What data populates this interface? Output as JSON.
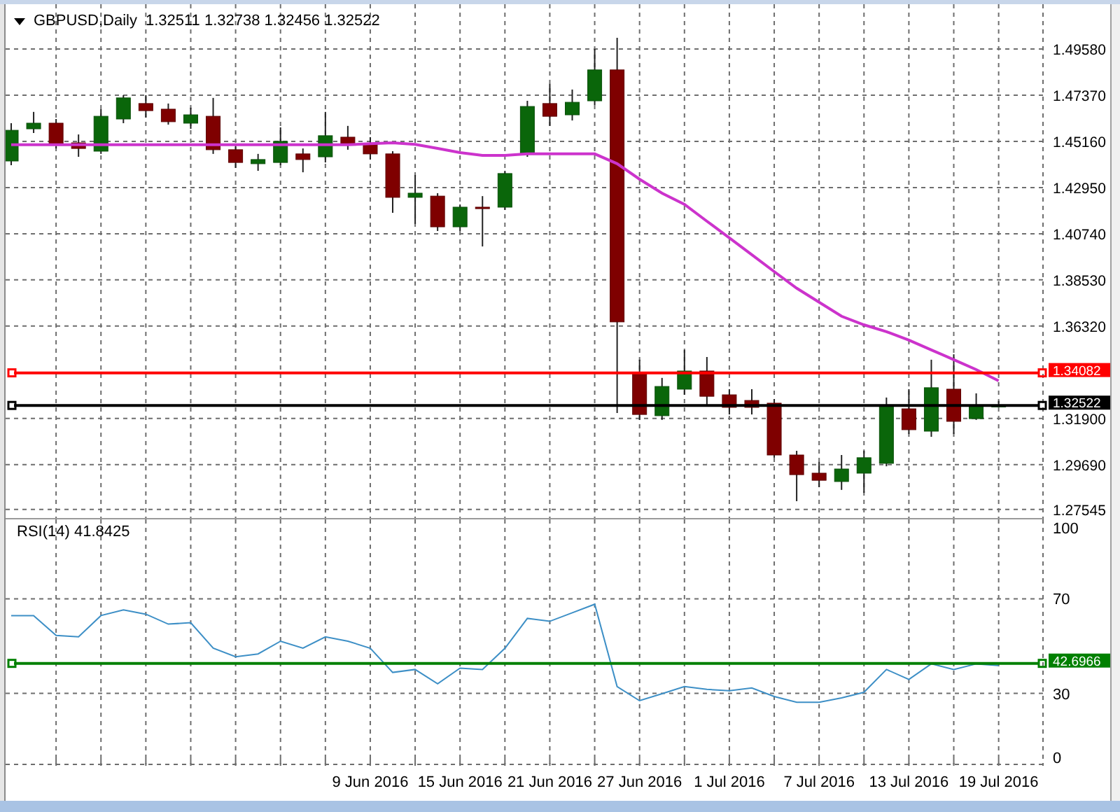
{
  "price_panel": {
    "symbol": "GBPUSD,Daily",
    "ohlc_text": "1.32511 1.32738 1.32456 1.32522",
    "chart_data": {
      "type": "candlestick",
      "grid": true,
      "ylim": [
        1.27068,
        1.51724
      ],
      "categories": [
        null,
        null,
        null,
        null,
        null,
        null,
        null,
        null,
        null,
        null,
        null,
        null,
        null,
        null,
        null,
        null,
        null,
        null,
        null,
        null,
        null,
        null,
        null,
        null,
        null,
        null,
        null,
        null,
        null,
        null,
        null,
        null,
        null,
        null,
        null,
        null,
        null,
        null,
        null,
        null,
        null,
        null,
        null,
        null,
        null
      ],
      "yticks": [
        {
          "value": 1.4958,
          "label": "1.49580"
        },
        {
          "value": 1.4737,
          "label": "1.47370"
        },
        {
          "value": 1.4516,
          "label": "1.45160"
        },
        {
          "value": 1.4295,
          "label": "1.42950"
        },
        {
          "value": 1.4074,
          "label": "1.40740"
        },
        {
          "value": 1.3853,
          "label": "1.38530"
        },
        {
          "value": 1.3632,
          "label": "1.36320"
        },
        {
          "value": 1.319,
          "label": "1.31900"
        },
        {
          "value": 1.2969,
          "label": "1.29690"
        },
        {
          "value": 1.27545,
          "label": "1.27545"
        }
      ],
      "ohlc": [
        [
          1.4422,
          1.4603,
          1.4402,
          1.4569
        ],
        [
          1.4576,
          1.4657,
          1.4556,
          1.4603
        ],
        [
          1.4603,
          1.4623,
          1.4482,
          1.4502
        ],
        [
          1.4509,
          1.4549,
          1.4442,
          1.4482
        ],
        [
          1.4469,
          1.467,
          1.4456,
          1.4636
        ],
        [
          1.4623,
          1.4737,
          1.4603,
          1.4724
        ],
        [
          1.4697,
          1.4737,
          1.463,
          1.4663
        ],
        [
          1.467,
          1.4697,
          1.4596,
          1.461
        ],
        [
          1.4603,
          1.4677,
          1.4576,
          1.4643
        ],
        [
          1.4636,
          1.4724,
          1.4456,
          1.4476
        ],
        [
          1.4476,
          1.4496,
          1.4389,
          1.4415
        ],
        [
          1.4409,
          1.4456,
          1.4375,
          1.4429
        ],
        [
          1.4415,
          1.4583,
          1.4402,
          1.4516
        ],
        [
          1.4456,
          1.4482,
          1.4368,
          1.4429
        ],
        [
          1.4442,
          1.4657,
          1.4415,
          1.4543
        ],
        [
          1.4536,
          1.459,
          1.4476,
          1.4502
        ],
        [
          1.4502,
          1.4536,
          1.4429,
          1.4456
        ],
        [
          1.4456,
          1.4469,
          1.4174,
          1.4248
        ],
        [
          1.4248,
          1.4355,
          1.4121,
          1.4268
        ],
        [
          1.4254,
          1.4268,
          1.4087,
          1.4107
        ],
        [
          1.4107,
          1.4214,
          1.4087,
          1.4201
        ],
        [
          1.4201,
          1.4254,
          1.4013,
          1.4194
        ],
        [
          1.4201,
          1.4375,
          1.4188,
          1.4362
        ],
        [
          1.4456,
          1.471,
          1.4442,
          1.4683
        ],
        [
          1.4697,
          1.4791,
          1.459,
          1.4636
        ],
        [
          1.4643,
          1.4764,
          1.4616,
          1.4703
        ],
        [
          1.471,
          1.4958,
          1.469,
          1.4858
        ],
        [
          1.4858,
          1.5012,
          1.3216,
          1.3652
        ],
        [
          1.3404,
          1.3471,
          1.3183,
          1.3209
        ],
        [
          1.3203,
          1.3384,
          1.3183,
          1.3343
        ],
        [
          1.333,
          1.3518,
          1.3303,
          1.3417
        ],
        [
          1.3417,
          1.3484,
          1.325,
          1.3296
        ],
        [
          1.3303,
          1.333,
          1.3209,
          1.3243
        ],
        [
          1.3276,
          1.333,
          1.3209,
          1.3243
        ],
        [
          1.3263,
          1.3283,
          1.3002,
          1.3015
        ],
        [
          1.3015,
          1.3035,
          1.2794,
          1.2921
        ],
        [
          1.2928,
          1.2982,
          1.2861,
          1.2894
        ],
        [
          1.2888,
          1.3015,
          1.2848,
          1.2948
        ],
        [
          1.2928,
          1.3035,
          1.2834,
          1.3002
        ],
        [
          1.2975,
          1.329,
          1.2961,
          1.325
        ],
        [
          1.3236,
          1.333,
          1.3116,
          1.3136
        ],
        [
          1.3129,
          1.3471,
          1.3102,
          1.3337
        ],
        [
          1.333,
          1.3497,
          1.3116,
          1.3176
        ],
        [
          1.3189,
          1.331,
          1.3183,
          1.325
        ],
        [
          1.3251,
          1.3274,
          1.3246,
          1.3252
        ]
      ],
      "series": [
        {
          "type": "line",
          "color": "#cc33cc",
          "values": [
            1.45,
            1.45,
            1.45,
            1.45,
            1.45,
            1.45,
            1.45,
            1.45,
            1.45,
            1.45,
            1.45,
            1.45,
            1.45,
            1.45,
            1.45,
            1.45,
            1.4505,
            1.4509,
            1.4502,
            1.4482,
            1.4462,
            1.4449,
            1.4449,
            1.4456,
            1.4456,
            1.4456,
            1.4456,
            1.4409,
            1.4335,
            1.4268,
            1.4214,
            1.4134,
            1.4054,
            1.3974,
            1.3893,
            1.3813,
            1.3746,
            1.3679,
            1.3638,
            1.3605,
            1.3565,
            1.3518,
            1.3471,
            1.3424,
            1.337
          ]
        }
      ],
      "ref_lines": [
        {
          "axis": "y",
          "value": 1.34082,
          "label": "1.34082",
          "color": "#ff0000"
        },
        {
          "axis": "y",
          "value": 1.32522,
          "label": "1.32522",
          "color": "#000000"
        }
      ]
    }
  },
  "rsi_panel": {
    "label": "RSI(14) 41.8425",
    "chart_data": {
      "type": "line",
      "grid": true,
      "ylim": [
        0,
        100
      ],
      "categories": [
        null,
        null,
        null,
        null,
        null,
        null,
        null,
        null,
        null,
        null,
        null,
        null,
        null,
        null,
        null,
        null,
        "9 Jun 2016",
        null,
        null,
        null,
        "15 Jun 2016",
        null,
        null,
        null,
        "21 Jun 2016",
        null,
        null,
        null,
        "27 Jun 2016",
        null,
        null,
        null,
        "1 Jul 2016",
        null,
        null,
        null,
        "7 Jul 2016",
        null,
        null,
        null,
        "13 Jul 2016",
        null,
        null,
        null,
        "19 Jul 2016"
      ],
      "yticks": [
        {
          "value": 100,
          "label": "100"
        },
        {
          "value": 70,
          "label": "70"
        },
        {
          "value": 30,
          "label": "30"
        },
        {
          "value": 0,
          "label": "0"
        }
      ],
      "series": [
        {
          "color": "#3d8fc6",
          "values": [
            62.9,
            62.9,
            54.5,
            53.9,
            62.9,
            65.3,
            63.5,
            59.3,
            59.9,
            49.1,
            45.5,
            46.7,
            52.1,
            49.1,
            53.9,
            52.1,
            49.1,
            38.9,
            40.1,
            34.1,
            40.7,
            40.1,
            49.1,
            61.7,
            60.5,
            64.1,
            67.7,
            32.9,
            26.9,
            29.9,
            32.9,
            31.7,
            31.1,
            32.3,
            28.7,
            26.3,
            26.3,
            28.1,
            30.5,
            40.1,
            35.9,
            42.5,
            40.1,
            42.5,
            41.8
          ]
        }
      ],
      "ref_lines": [
        {
          "axis": "y",
          "value": 42.6966,
          "label": "42.6966",
          "color": "#008000"
        }
      ]
    }
  }
}
